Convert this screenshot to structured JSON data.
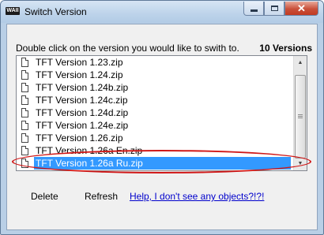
{
  "window": {
    "app_icon_text": "WAII",
    "title": "Switch Version",
    "icons": [
      "minimize-icon",
      "maximize-icon",
      "close-icon"
    ]
  },
  "instruction": "Double click on the version you would like to swith to.",
  "version_count": "10 Versions",
  "versions": [
    "TFT Version 1.23.zip",
    "TFT Version 1.24.zip",
    "TFT Version 1.24b.zip",
    "TFT Version 1.24c.zip",
    "TFT Version 1.24d.zip",
    "TFT Version 1.24e.zip",
    "TFT Version 1.26.zip",
    "TFT Version 1.26a En.zip",
    "TFT Version 1.26a Ru.zip"
  ],
  "selected_version": "TFT Version 1.26a Ru.zip",
  "buttons": {
    "delete": "Delete",
    "refresh": "Refresh",
    "help": "Help, I don't see any objects?!?!"
  },
  "colors": {
    "selection": "#3399ff",
    "annotation": "#d01818",
    "link": "#0000cc"
  }
}
